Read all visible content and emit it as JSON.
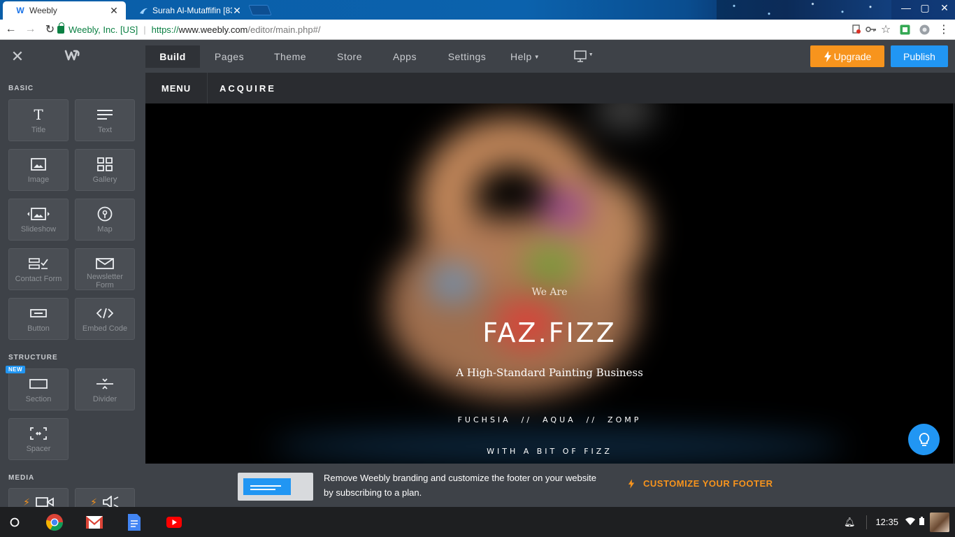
{
  "browser": {
    "tabs": [
      {
        "title": "Weebly",
        "active": true
      },
      {
        "title": "Surah Al-Mutaffifin [83] -",
        "active": false
      }
    ],
    "address": {
      "ev_label": "Weebly, Inc. [US]",
      "scheme": "https://",
      "host": "www.weebly.com",
      "path": "/editor/main.php#/"
    }
  },
  "editor": {
    "nav": {
      "build": "Build",
      "pages": "Pages",
      "theme": "Theme",
      "store": "Store",
      "apps": "Apps",
      "settings": "Settings",
      "help": "Help"
    },
    "upgrade_label": "Upgrade",
    "publish_label": "Publish"
  },
  "sidebar": {
    "basic_heading": "BASIC",
    "structure_heading": "STRUCTURE",
    "media_heading": "MEDIA",
    "new_badge": "NEW",
    "tiles": {
      "title": "Title",
      "text": "Text",
      "image": "Image",
      "gallery": "Gallery",
      "slideshow": "Slideshow",
      "map": "Map",
      "contact_form": "Contact Form",
      "newsletter_form": "Newsletter Form",
      "button": "Button",
      "embed_code": "Embed Code",
      "section": "Section",
      "divider": "Divider",
      "spacer": "Spacer"
    }
  },
  "site": {
    "menu_label": "MENU",
    "site_name": "ACQUIRE",
    "hero": {
      "intro": "We Are",
      "brand": "FAZ.FIZZ",
      "tagline": "A High-Standard Painting Business",
      "colors_line": "FUCHSIA  //  AQUA  //  ZOMP",
      "fizz_line": "WITH A BIT OF FIZZ"
    }
  },
  "promo": {
    "text": "Remove Weebly branding and customize the footer on your website by subscribing to a plan.",
    "link": "CUSTOMIZE YOUR FOOTER"
  },
  "shelf": {
    "time": "12:35"
  },
  "colors": {
    "accent_orange": "#f7941d",
    "accent_blue": "#2196f3",
    "editor_bg": "#3e4248"
  }
}
